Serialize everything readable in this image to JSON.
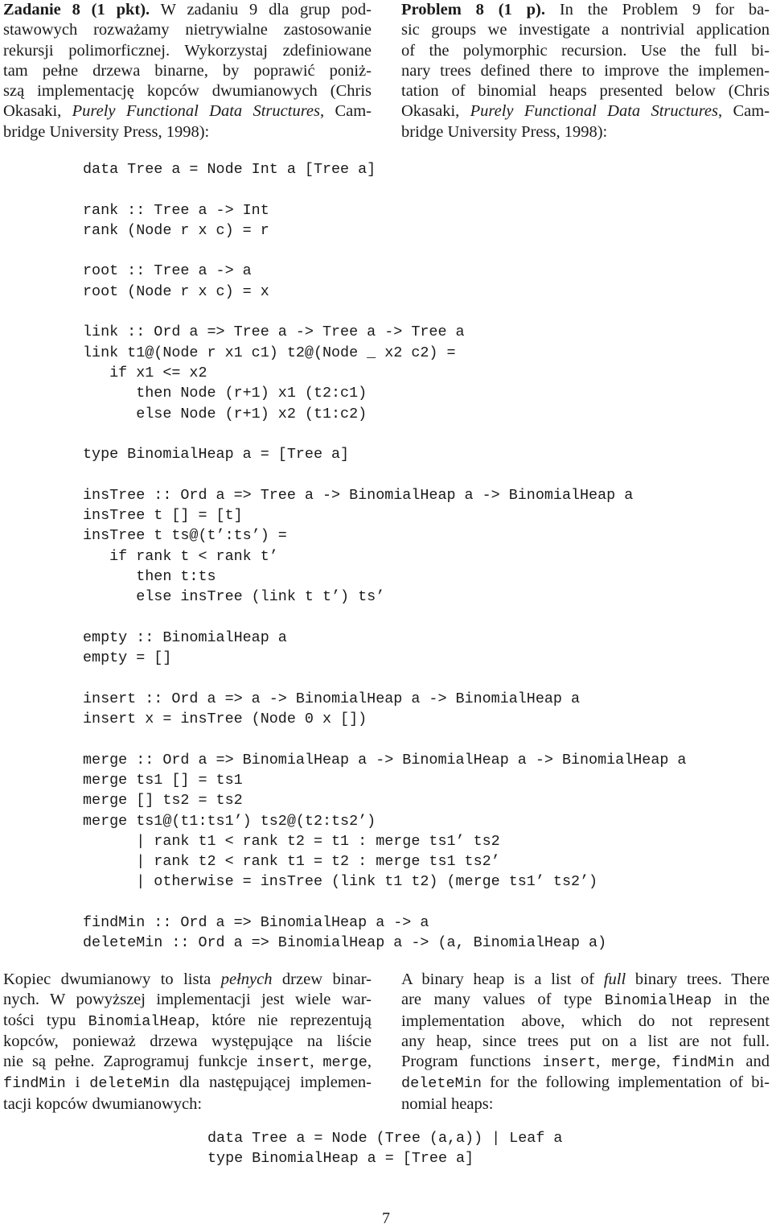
{
  "problem_pl": {
    "heading": "Zadanie 8 (1 pkt).",
    "lines": [
      " W zadaniu 9 dla grup pod-",
      "stawowych rozważamy nietrywialne zastosowanie",
      "rekursji polimorficznej. Wykorzystaj zdefiniowane",
      "tam pełne drzewa binarne, by poprawić poniż-",
      "szą implementację kopców dwumianowych (Chris"
    ],
    "line6_pre": "Okasaki, ",
    "line6_italic": "Purely Functional Data Structures",
    "line6_post": ", Cam-",
    "line7": "bridge University Press, 1998):"
  },
  "problem_en": {
    "heading": "Problem 8 (1 p).",
    "lines": [
      " In the Problem 9 for ba-",
      "sic groups we investigate a nontrivial application",
      "of the polymorphic recursion.  Use the full bi-",
      "nary trees defined there to improve the implemen-",
      "tation of binomial heaps presented below (Chris"
    ],
    "line6_pre": "Okasaki, ",
    "line6_italic": "Purely Functional Data Structures",
    "line6_post": ", Cam-",
    "line7": "bridge University Press, 1998):"
  },
  "code_main": [
    "data Tree a = Node Int a [Tree a]",
    "",
    "rank :: Tree a -> Int",
    "rank (Node r x c) = r",
    "",
    "root :: Tree a -> a",
    "root (Node r x c) = x",
    "",
    "link :: Ord a => Tree a -> Tree a -> Tree a",
    "link t1@(Node r x1 c1) t2@(Node _ x2 c2) =",
    "   if x1 <= x2",
    "      then Node (r+1) x1 (t2:c1)",
    "      else Node (r+1) x2 (t1:c2)",
    "",
    "type BinomialHeap a = [Tree a]",
    "",
    "insTree :: Ord a => Tree a -> BinomialHeap a -> BinomialHeap a",
    "insTree t [] = [t]",
    "insTree t ts@(t’:ts’) =",
    "   if rank t < rank t’",
    "      then t:ts",
    "      else insTree (link t t’) ts’",
    "",
    "empty :: BinomialHeap a",
    "empty = []",
    "",
    "insert :: Ord a => a -> BinomialHeap a -> BinomialHeap a",
    "insert x = insTree (Node 0 x [])",
    "",
    "merge :: Ord a => BinomialHeap a -> BinomialHeap a -> BinomialHeap a",
    "merge ts1 [] = ts1",
    "merge [] ts2 = ts2",
    "merge ts1@(t1:ts1’) ts2@(t2:ts2’)",
    "      | rank t1 < rank t2 = t1 : merge ts1’ ts2",
    "      | rank t2 < rank t1 = t2 : merge ts1 ts2’",
    "      | otherwise = insTree (link t1 t2) (merge ts1’ ts2’)",
    "",
    "findMin :: Ord a => BinomialHeap a -> a",
    "deleteMin :: Ord a => BinomialHeap a -> (a, BinomialHeap a)"
  ],
  "task_pl": {
    "l1_pre": "Kopiec dwumianowy to lista ",
    "l1_italic": "pełnych",
    "l1_post": " drzew binar-",
    "l2": "nych.  W powyższej implementacji jest wiele war-",
    "l3_pre": "tości typu ",
    "l3_code": "BinomialHeap",
    "l3_post": ", które nie reprezentują",
    "l4": "kopców,  ponieważ drzewa występujące na liście",
    "l5_pre": "nie są pełne. Zaprogramuj funkcje ",
    "l5_code1": "insert",
    "l5_mid": ", ",
    "l5_code2": "merge",
    "l5_post": ",",
    "l6_code1": "findMin",
    "l6_mid": " i ",
    "l6_code2": "deleteMin",
    "l6_post": " dla następującej implemen-",
    "l7": "tacji kopców dwumianowych:"
  },
  "task_en": {
    "l1_pre": "A binary heap is a list of ",
    "l1_italic": "full",
    "l1_post": " binary trees. There",
    "l2_pre": "are many values of type ",
    "l2_code": "BinomialHeap",
    "l2_post": " in the",
    "l3": "implementation above, which do not represent",
    "l4": "any heap, since trees put on a list are not full.",
    "l5_pre": "Program functions ",
    "l5_code1": "insert",
    "l5_mid1": ", ",
    "l5_code2": "merge",
    "l5_mid2": ", ",
    "l5_code3": "findMin",
    "l5_post": " and",
    "l6_code": "deleteMin",
    "l6_post": " for the following implementation of bi-",
    "l7": "nomial heaps:"
  },
  "code_bottom": [
    "data Tree a = Node (Tree (a,a)) | Leaf a",
    "type BinomialHeap a = [Tree a]"
  ],
  "page_number": "7"
}
